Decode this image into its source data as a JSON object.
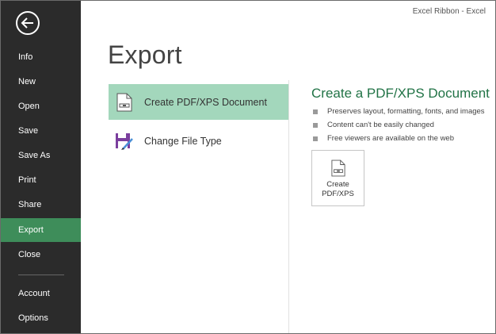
{
  "window": {
    "title": "Excel Ribbon - Excel"
  },
  "sidebar": {
    "back_icon": "back-arrow-icon",
    "items": [
      {
        "label": "Info",
        "active": false
      },
      {
        "label": "New",
        "active": false
      },
      {
        "label": "Open",
        "active": false
      },
      {
        "label": "Save",
        "active": false
      },
      {
        "label": "Save As",
        "active": false
      },
      {
        "label": "Print",
        "active": false
      },
      {
        "label": "Share",
        "active": false
      },
      {
        "label": "Export",
        "active": true
      },
      {
        "label": "Close",
        "active": false
      },
      {
        "label": "Account",
        "active": false
      },
      {
        "label": "Options",
        "active": false
      }
    ]
  },
  "main": {
    "title": "Export",
    "options": [
      {
        "label": "Create PDF/XPS Document",
        "icon": "pdf-document-icon",
        "selected": true
      },
      {
        "label": "Change File Type",
        "icon": "change-file-type-icon",
        "selected": false
      }
    ]
  },
  "detail": {
    "title": "Create a PDF/XPS Document",
    "bullets": [
      "Preserves layout, formatting, fonts, and images",
      "Content can't be easily changed",
      "Free viewers are available on the web"
    ],
    "button_line1": "Create",
    "button_line2": "PDF/XPS",
    "button_icon": "pdf-document-icon"
  },
  "colors": {
    "sidebar_bg": "#2b2b2b",
    "active_nav": "#3e8d5a",
    "selected_option": "#a3d7bc",
    "accent_green": "#217346",
    "change_type_icon": "#7b3f9e"
  }
}
